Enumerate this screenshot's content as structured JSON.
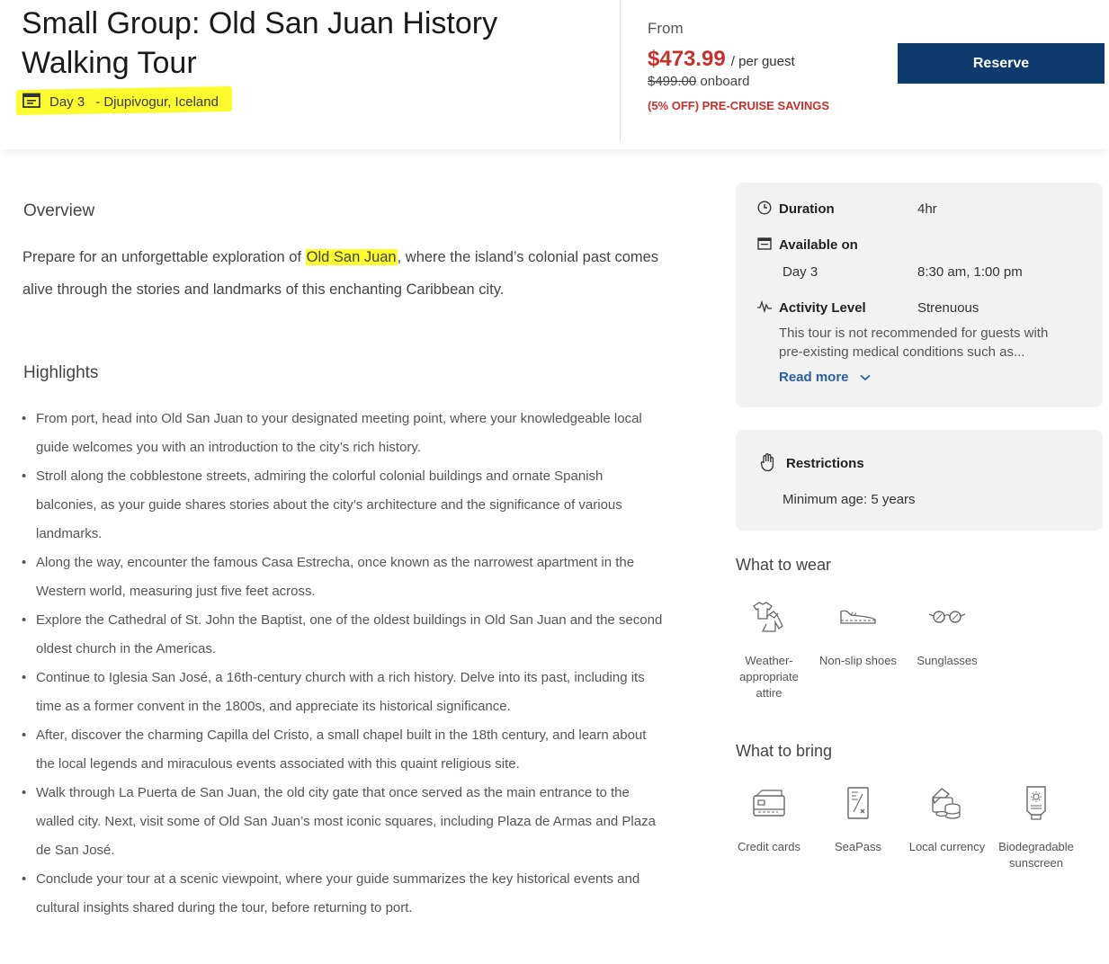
{
  "header": {
    "title": "Small Group: Old San Juan History Walking Tour",
    "day": "Day 3",
    "location": "- Djupivogur, Iceland",
    "from_label": "From",
    "price": "$473.99",
    "per_guest": "/ per guest",
    "original_price": "$499.00",
    "onboard": "onboard",
    "savings": "(5% OFF) PRE-CRUISE SAVINGS",
    "reserve_label": "Reserve"
  },
  "overview": {
    "heading": "Overview",
    "text_before": "Prepare for an unforgettable exploration of ",
    "highlight": "Old San Juan",
    "text_after": ", where the island’s colonial past comes alive through the stories and landmarks of this enchanting Caribbean city."
  },
  "highlights": {
    "heading": "Highlights",
    "items": [
      "From port, head into Old San Juan to your designated meeting point, where your knowledgeable local guide welcomes you with an introduction to the city’s rich history.",
      "Stroll along the cobblestone streets, admiring the colorful colonial buildings and ornate Spanish balconies, as your guide shares stories about the city’s architecture and the significance of various landmarks.",
      "Along the way, encounter the famous Casa Estrecha, once known as the narrowest apartment in the Western world, measuring just five feet across.",
      "Explore the Cathedral of St. John the Baptist, one of the oldest buildings in Old San Juan and the second oldest church in the Americas.",
      "Continue to Iglesia San José, a 16th-century church with a rich history. Delve into its past, including its time as a former convent in the 1800s, and appreciate its historical significance.",
      "After, discover the charming Capilla del Cristo, a small chapel built in the 18th century, and learn about the local legends and miraculous events associated with this quaint religious site.",
      "Walk through La Puerta de San Juan, the old city gate that once served as the main entrance to the walled city. Next, visit some of Old San Juan’s most iconic squares, including Plaza de Armas and Plaza de San José.",
      "Conclude your tour at a scenic viewpoint, where your guide summarizes the key historical events and cultural insights shared during the tour, before returning to port."
    ]
  },
  "details": {
    "duration_label": "Duration",
    "duration_value": "4hr",
    "available_label": "Available on",
    "available_day": "Day 3",
    "available_times": "8:30 am, 1:00 pm",
    "activity_label": "Activity Level",
    "activity_value": "Strenuous",
    "activity_note": "This tour is not recommended for guests with pre-existing medical conditions such as...",
    "read_more": "Read more"
  },
  "restrictions": {
    "label": "Restrictions",
    "min_age": "Minimum age: 5 years"
  },
  "what_to_wear": {
    "heading": "What to wear",
    "items": [
      {
        "label": "Weather-appropriate attire",
        "icon": "clothes-icon"
      },
      {
        "label": "Non-slip shoes",
        "icon": "shoe-icon"
      },
      {
        "label": "Sunglasses",
        "icon": "sunglasses-icon"
      }
    ]
  },
  "what_to_bring": {
    "heading": "What to bring",
    "items": [
      {
        "label": "Credit cards",
        "icon": "credit-card-icon"
      },
      {
        "label": "SeaPass",
        "icon": "seapass-icon"
      },
      {
        "label": "Local currency",
        "icon": "currency-icon"
      },
      {
        "label": "Biodegradable sunscreen",
        "icon": "sunscreen-icon"
      }
    ]
  },
  "colors": {
    "price_red": "#c8302e",
    "reserve_blue": "#0d3b6e",
    "link_blue": "#2b5f9e",
    "highlight_yellow": "#fbfb2e",
    "card_bg": "#f2f2f2"
  }
}
